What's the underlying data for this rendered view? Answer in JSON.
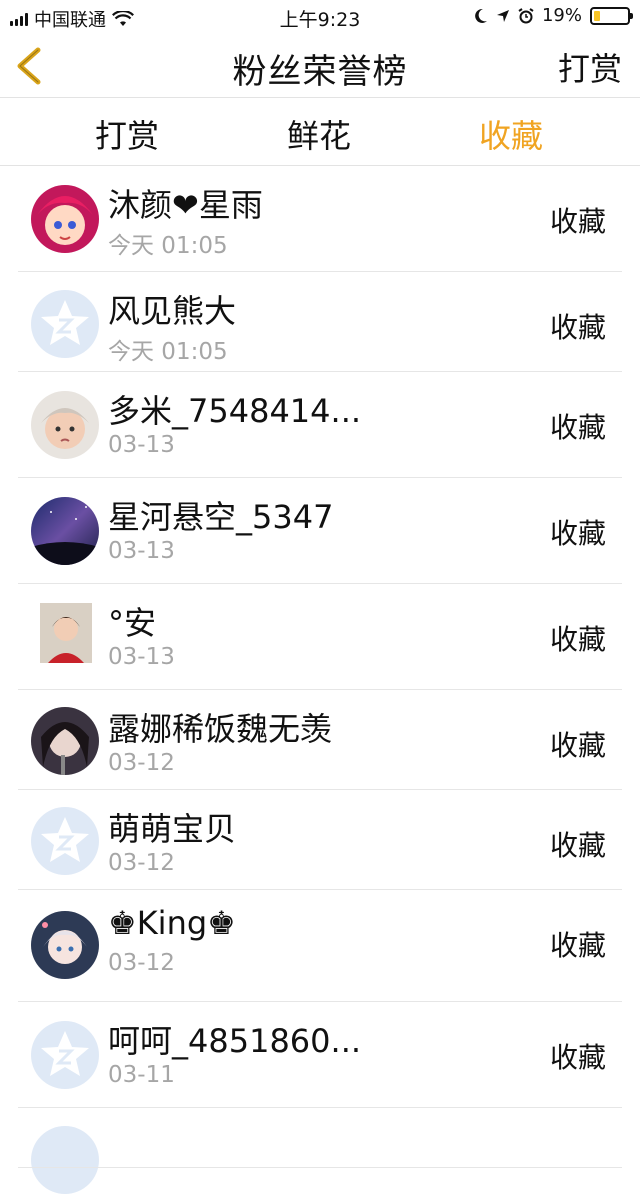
{
  "status_bar": {
    "carrier": "中国联通",
    "time": "上午9:23",
    "battery": "19%",
    "battery_level": 0.19,
    "icons": [
      "signal-icon",
      "wifi-icon",
      "moon-icon",
      "location-icon",
      "alarm-icon",
      "battery-icon"
    ]
  },
  "nav": {
    "title": "粉丝荣誉榜",
    "right_label": "打赏",
    "back_icon": "chevron-left-icon"
  },
  "tabs": [
    {
      "label": "打赏",
      "active": false
    },
    {
      "label": "鲜花",
      "active": false
    },
    {
      "label": "收藏",
      "active": true
    }
  ],
  "colors": {
    "accent": "#f0a422",
    "secondary_text": "#a6a6a6",
    "divider": "#e6e6e6"
  },
  "list": [
    {
      "name": "沐颜❤星雨",
      "time": "今天 01:05",
      "action": "收藏",
      "avatar": "cartoon-girl-avatar"
    },
    {
      "name": "风见熊大",
      "time": "今天 01:05",
      "action": "收藏",
      "avatar": "default-avatar"
    },
    {
      "name": "多米_7548414...",
      "time": "03-13",
      "action": "收藏",
      "avatar": "baby-photo-avatar"
    },
    {
      "name": "星河悬空_5347",
      "time": "03-13",
      "action": "收藏",
      "avatar": "galaxy-avatar"
    },
    {
      "name": "°安",
      "time": "03-13",
      "action": "收藏",
      "avatar": "girl-photo-avatar"
    },
    {
      "name": "露娜稀饭魏无羡",
      "time": "03-12",
      "action": "收藏",
      "avatar": "anime-avatar"
    },
    {
      "name": "萌萌宝贝",
      "time": "03-12",
      "action": "收藏",
      "avatar": "default-avatar"
    },
    {
      "name": "♚King♚",
      "time": "03-12",
      "action": "收藏",
      "avatar": "anime-girl-avatar"
    },
    {
      "name": "呵呵_4851860...",
      "time": "03-11",
      "action": "收藏",
      "avatar": "default-avatar"
    },
    {
      "name": "",
      "time": "",
      "action": "",
      "avatar": "default-avatar"
    }
  ]
}
